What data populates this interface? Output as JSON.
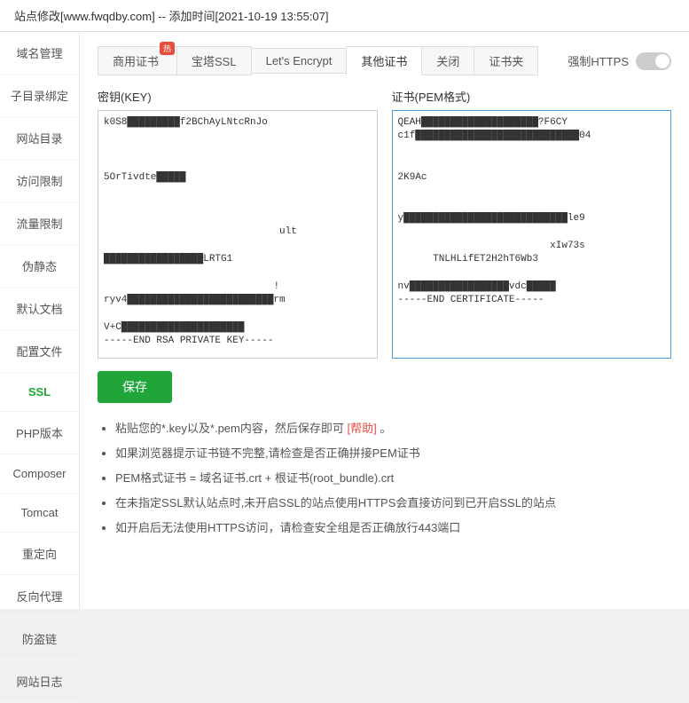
{
  "titleBar": {
    "text": "站点修改[www.fwqdby.com] -- 添加时间[2021-10-19 13:55:07]"
  },
  "sidebar": {
    "items": [
      {
        "label": "域名管理",
        "id": "domain"
      },
      {
        "label": "子目录绑定",
        "id": "subdir"
      },
      {
        "label": "网站目录",
        "id": "webdir"
      },
      {
        "label": "访问限制",
        "id": "access"
      },
      {
        "label": "流量限制",
        "id": "traffic"
      },
      {
        "label": "伪静态",
        "id": "rewrite"
      },
      {
        "label": "默认文档",
        "id": "defaultdoc"
      },
      {
        "label": "配置文件",
        "id": "config"
      },
      {
        "label": "SSL",
        "id": "ssl",
        "active": true
      },
      {
        "label": "PHP版本",
        "id": "php"
      },
      {
        "label": "Composer",
        "id": "composer"
      },
      {
        "label": "Tomcat",
        "id": "tomcat"
      },
      {
        "label": "重定向",
        "id": "redirect"
      },
      {
        "label": "反向代理",
        "id": "proxy"
      },
      {
        "label": "防盗链",
        "id": "hotlink"
      },
      {
        "label": "网站日志",
        "id": "log"
      }
    ]
  },
  "tabs": [
    {
      "label": "商用证书",
      "id": "commercial",
      "badge": "热"
    },
    {
      "label": "宝塔SSL",
      "id": "baota"
    },
    {
      "label": "Let's Encrypt",
      "id": "letsencrypt"
    },
    {
      "label": "其他证书",
      "id": "other",
      "active": true
    },
    {
      "label": "关闭",
      "id": "close"
    },
    {
      "label": "证书夹",
      "id": "certfolder"
    }
  ],
  "forceHttps": {
    "label": "强制HTTPS"
  },
  "keySection": {
    "label": "密钥(KEY)",
    "topLine": "k0S8█████████f2BChAyLNtcRnJo",
    "midLine1": "5OrTivdte█████",
    "midLine2": "█████████████████████████████ult",
    "midLine3": "█████████████████LRTG1",
    "midLine4": "ryv4█████████████████████████rm",
    "bottomLine": "V+C█████████████████████",
    "endLine": "-----END RSA PRIVATE KEY-----"
  },
  "certSection": {
    "label": "证书(PEM格式)",
    "topLine": "QEAH████████████████████?F6CY",
    "line1": "c1f█████████████████████████████04",
    "line2": "2K9Ac",
    "line3": "y█████████████████████████████le9",
    "line4": "████████████████████xIw73s",
    "line5": "TNLHLifET2H2hT6Wb3",
    "line6": "nv█████████████████vdc█████",
    "endLine": "-----END CERTIFICATE-----"
  },
  "saveButton": {
    "label": "保存"
  },
  "tips": [
    {
      "text": "粘贴您的*.key以及*.pem内容，然后保存即可",
      "linkText": "帮助",
      "hasLink": true
    },
    {
      "text": "如果浏览器提示证书链不完整,请检查是否正确拼接PEM证书"
    },
    {
      "text": "PEM格式证书 = 域名证书.crt + 根证书(root_bundle).crt"
    },
    {
      "text": "在未指定SSL默认站点时,未开启SSL的站点使用HTTPS会直接访问到已开启SSL的站点"
    },
    {
      "text": "如开启后无法使用HTTPS访问，请检查安全组是否正确放行443端口"
    }
  ]
}
